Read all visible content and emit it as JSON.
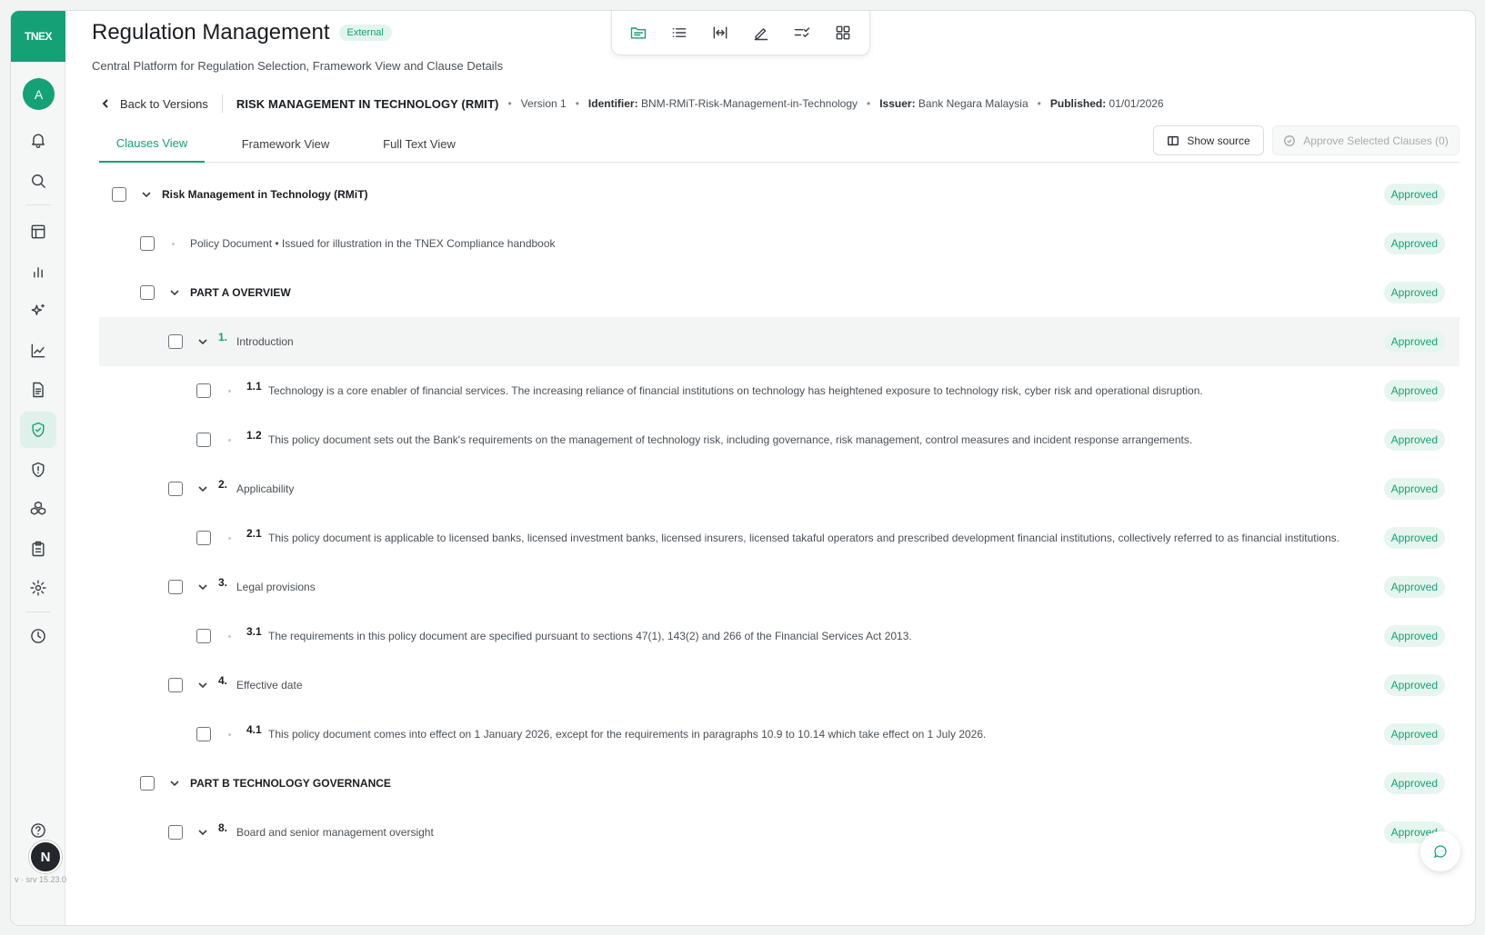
{
  "app": {
    "logo": "TNEX",
    "avatar_initial": "A",
    "user_initial": "N",
    "version": "v · srv 15.23.0"
  },
  "header": {
    "title": "Regulation Management",
    "badge": "External",
    "subtitle": "Central Platform for Regulation Selection, Framework View and Clause Details"
  },
  "toolbar": {
    "icons": [
      "folder-icon",
      "list-icon",
      "fit-width-icon",
      "edit-icon",
      "checklist-icon",
      "grid-icon"
    ]
  },
  "breadcrumb": {
    "back": "Back to Versions",
    "regulation": "RISK MANAGEMENT IN TECHNOLOGY (RMIT)",
    "version": "Version 1",
    "identifier_label": "Identifier:",
    "identifier": "BNM-RMiT-Risk-Management-in-Technology",
    "issuer_label": "Issuer:",
    "issuer": "Bank Negara Malaysia",
    "published_label": "Published:",
    "published": "01/01/2026"
  },
  "tabs": [
    "Clauses View",
    "Framework View",
    "Full Text View"
  ],
  "actions": {
    "show_source": "Show source",
    "approve": "Approve Selected Clauses (0)"
  },
  "rows": [
    {
      "level": 0,
      "chevron": true,
      "num": "",
      "text": "Risk Management in Technology (RMiT)",
      "bold": true,
      "status": "Approved"
    },
    {
      "level": 1,
      "chevron": false,
      "num": "",
      "text": "Policy Document • Issued for illustration in the TNEX Compliance handbook",
      "bold": false,
      "status": "Approved"
    },
    {
      "level": 1,
      "chevron": true,
      "num": "",
      "text": "PART A OVERVIEW",
      "bold": true,
      "status": "Approved"
    },
    {
      "level": 2,
      "chevron": true,
      "num": "1.",
      "text": "Introduction",
      "bold": false,
      "status": "Approved"
    },
    {
      "level": 3,
      "chevron": false,
      "num": "1.1",
      "text": "Technology is a core enabler of financial services. The increasing reliance of financial institutions on technology has heightened exposure to technology risk, cyber risk and operational disruption.",
      "bold": false,
      "status": "Approved"
    },
    {
      "level": 3,
      "chevron": false,
      "num": "1.2",
      "text": "This policy document sets out the Bank's requirements on the management of technology risk, including governance, risk management, control measures and incident response arrangements.",
      "bold": false,
      "status": "Approved"
    },
    {
      "level": 2,
      "chevron": true,
      "num": "2.",
      "text": "Applicability",
      "bold": false,
      "status": "Approved"
    },
    {
      "level": 3,
      "chevron": false,
      "num": "2.1",
      "text": "This policy document is applicable to licensed banks, licensed investment banks, licensed insurers, licensed takaful operators and prescribed development financial institutions, collectively referred to as financial institutions.",
      "bold": false,
      "status": "Approved"
    },
    {
      "level": 2,
      "chevron": true,
      "num": "3.",
      "text": "Legal provisions",
      "bold": false,
      "status": "Approved"
    },
    {
      "level": 3,
      "chevron": false,
      "num": "3.1",
      "text": "The requirements in this policy document are specified pursuant to sections 47(1), 143(2) and 266 of the Financial Services Act 2013.",
      "bold": false,
      "status": "Approved"
    },
    {
      "level": 2,
      "chevron": true,
      "num": "4.",
      "text": "Effective date",
      "bold": false,
      "status": "Approved"
    },
    {
      "level": 3,
      "chevron": false,
      "num": "4.1",
      "text": "This policy document comes into effect on 1 January 2026, except for the requirements in paragraphs 10.9 to 10.14 which take effect on 1 July 2026.",
      "bold": false,
      "status": "Approved"
    },
    {
      "level": 1,
      "chevron": true,
      "num": "",
      "text": "PART B TECHNOLOGY GOVERNANCE",
      "bold": true,
      "status": "Approved"
    },
    {
      "level": 2,
      "chevron": true,
      "num": "8.",
      "text": "Board and senior management oversight",
      "bold": false,
      "status": "Approved"
    }
  ]
}
